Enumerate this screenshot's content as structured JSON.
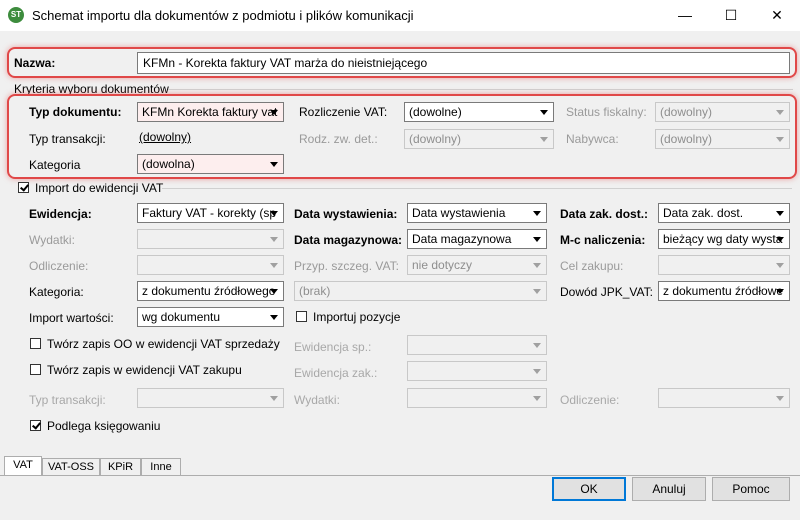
{
  "window": {
    "title": "Schemat importu dla dokumentów z podmiotu i plików komunikacji",
    "app_icon_text": "ST",
    "minimize": "—",
    "maximize": "☐",
    "close": "✕"
  },
  "name_field": {
    "label": "Nazwa:",
    "value": "KFMn - Korekta faktury VAT marża do nieistniejącego"
  },
  "kryteria": {
    "title": "Kryteria wyboru dokumentów",
    "typ_dokumentu": {
      "label": "Typ dokumentu:",
      "value": "KFMn Korekta faktury vat"
    },
    "rozliczenie_vat": {
      "label": "Rozliczenie VAT:",
      "value": "(dowolne)"
    },
    "status_fiskalny": {
      "label": "Status fiskalny:",
      "value": "(dowolny)"
    },
    "typ_transakcji": {
      "label": "Typ transakcji:",
      "value": "(dowolny)"
    },
    "rodz_zw_det": {
      "label": "Rodz. zw. det.:",
      "value": "(dowolny)"
    },
    "nabywca": {
      "label": "Nabywca:",
      "value": "(dowolny)"
    },
    "kategoria": {
      "label": "Kategoria",
      "value": "(dowolna)"
    }
  },
  "import_vat": {
    "label": "Import do ewidencji VAT",
    "ewidencja": {
      "label": "Ewidencja:",
      "value": "Faktury VAT - korekty (sp"
    },
    "data_wystawienia": {
      "label": "Data wystawienia:",
      "value": "Data wystawienia"
    },
    "data_zak_dost": {
      "label": "Data zak. dost.:",
      "value": "Data zak. dost."
    },
    "wydatki": {
      "label": "Wydatki:",
      "value": ""
    },
    "data_magazynowa": {
      "label": "Data magazynowa:",
      "value": "Data magazynowa"
    },
    "mc_naliczenia": {
      "label": "M-c naliczenia:",
      "value": "bieżący wg daty wysta"
    },
    "odliczenie": {
      "label": "Odliczenie:",
      "value": ""
    },
    "przyp_szczeg_vat": {
      "label": "Przyp. szczeg. VAT:",
      "value": "nie dotyczy"
    },
    "cel_zakupu": {
      "label": "Cel zakupu:",
      "value": ""
    },
    "kategoria": {
      "label": "Kategoria:",
      "value": "z dokumentu źródłowego"
    },
    "kategoria_brak": {
      "value": "(brak)"
    },
    "dowod_jpk": {
      "label": "Dowód JPK_VAT:",
      "value": "z dokumentu źródłowe"
    },
    "import_wartosci": {
      "label": "Import wartości:",
      "value": "wg dokumentu"
    },
    "importuj_pozycje": {
      "label": "Importuj pozycje"
    },
    "tworz_oo": {
      "label": "Twórz zapis OO w ewidencji VAT sprzedaży"
    },
    "ewidencja_sp": {
      "label": "Ewidencja sp.:",
      "value": ""
    },
    "tworz_zakup": {
      "label": "Twórz zapis w ewidencji VAT zakupu"
    },
    "ewidencja_zak": {
      "label": "Ewidencja zak.:",
      "value": ""
    },
    "typ_transakcji": {
      "label": "Typ transakcji:",
      "value": ""
    },
    "wydatki2": {
      "label": "Wydatki:",
      "value": ""
    },
    "odliczenie2": {
      "label": "Odliczenie:",
      "value": ""
    },
    "podlega": {
      "label": "Podlega księgowaniu"
    }
  },
  "tabs": [
    "VAT",
    "VAT-OSS",
    "KPiR",
    "Inne"
  ],
  "buttons": {
    "ok": "OK",
    "cancel": "Anuluj",
    "help": "Pomoc"
  },
  "colors": {
    "highlight": "#e04848",
    "accent": "#0078d7"
  }
}
